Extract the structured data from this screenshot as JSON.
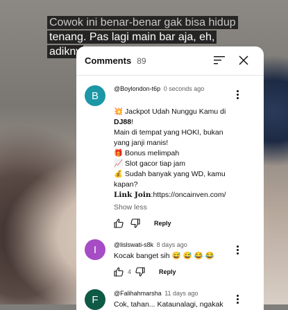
{
  "subtitle": {
    "line1": "Cowok ini benar-benar gak bisa hidup",
    "line2": "tenang. Pas lagi main bar aja, eh,",
    "line3": "adikny"
  },
  "comments_panel": {
    "title": "Comments",
    "count": "89",
    "icons": {
      "sort": "sort-icon",
      "close": "close-icon"
    }
  },
  "comments": [
    {
      "avatar_letter": "B",
      "avatar_color": "#1c97a6",
      "author": "@Boylondon-t6p",
      "time": "0 seconds ago",
      "line1a": "💥 Jackpot Udah Nunggu Kamu di",
      "line1b": "DJ88",
      "line1c": "!",
      "body_rest": "Main di tempat yang HOKI, bukan yang janji manis!\n🎁 Bonus melimpah\n📈 Slot gacor tiap jam\n💰 Sudah banyak yang WD, kamu kapan?",
      "link_label": "Link Join",
      "link_url": ":https://oncainven.com/",
      "show_less": "Show less",
      "reply": "Reply"
    },
    {
      "avatar_letter": "I",
      "avatar_color": "#a64cc4",
      "author": "@lislswati-s8k",
      "time": "8 days ago",
      "body": "Kocak banget sih 😅 😅 😂 😂",
      "likes": "4",
      "reply": "Reply"
    },
    {
      "avatar_letter": "F",
      "avatar_color": "#0f5a45",
      "author": "@Falihahmarsha",
      "time": "11 days ago",
      "body": "Cok, tahan... Kataunalagi, ngakak"
    }
  ],
  "colors": {
    "accent": "#0f0f0f",
    "muted": "#606060"
  }
}
